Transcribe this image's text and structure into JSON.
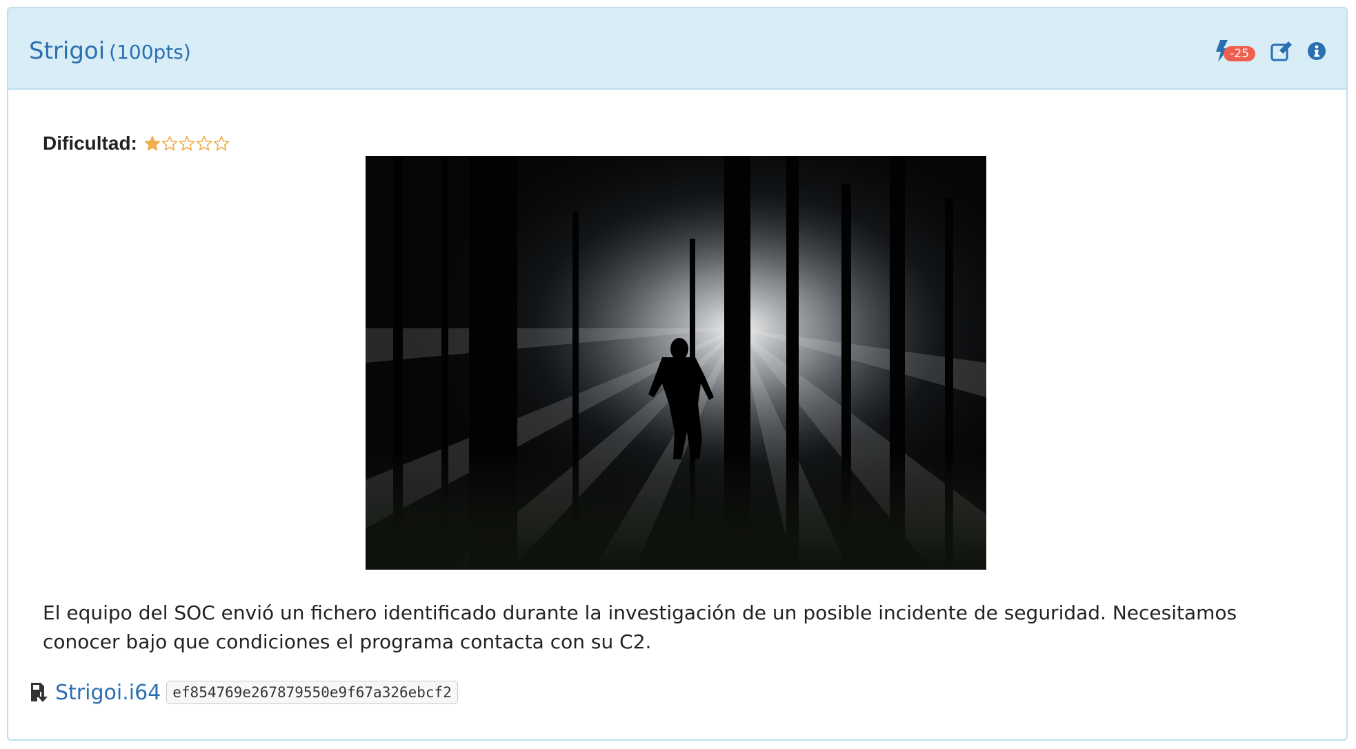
{
  "challenge": {
    "name": "Strigoi",
    "points": "(100pts)"
  },
  "header_tools": {
    "hint_icon": "bolt-icon",
    "hint_badge": "-25",
    "edit_icon": "edit-icon",
    "info_icon": "info-icon"
  },
  "difficulty": {
    "label": "Dificultad:",
    "rating": 1,
    "max": 5,
    "star_color": "#f0ad4e"
  },
  "description": "El equipo del SOC envió un fichero identificado durante la investigación de un posible incidente de seguridad. Necesitamos conocer bajo que condiciones el programa contacta con su C2.",
  "attachment": {
    "icon": "file-download-icon",
    "filename": "Strigoi.i64",
    "hash": "ef854769e267879550e9f67a326ebcf2"
  },
  "colors": {
    "heading_bg": "#d9edf7",
    "accent": "#2a6fb0",
    "badge": "#ee5f4f"
  }
}
